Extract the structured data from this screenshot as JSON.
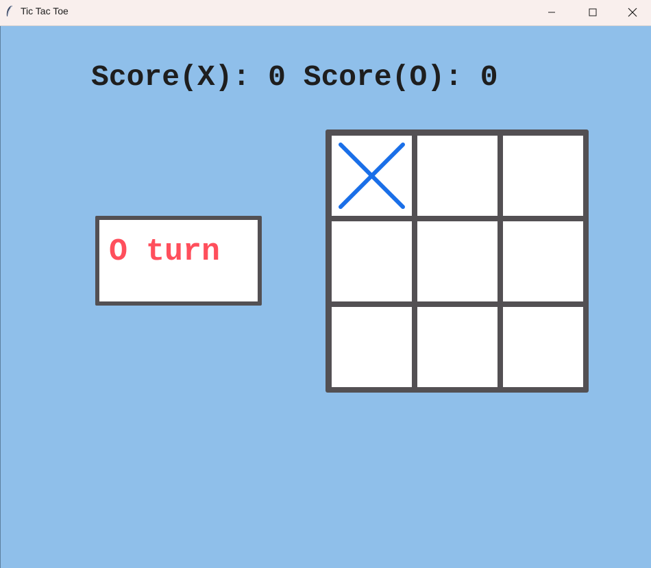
{
  "window": {
    "title": "Tic Tac Toe",
    "controls": [
      "minimize-icon",
      "maximize-icon",
      "close-icon"
    ]
  },
  "score": {
    "x_label": "Score(X):",
    "x_value": "0",
    "o_label": "Score(O):",
    "o_value": "0"
  },
  "turn": {
    "text": "O turn",
    "color": "#ff4f5c"
  },
  "board": {
    "cells": [
      "X",
      "",
      "",
      "",
      "",
      "",
      "",
      "",
      ""
    ],
    "x_color": "#1a6fe8",
    "grid_color": "#535053",
    "cell_color": "#ffffff"
  },
  "colors": {
    "background": "#8fbfea",
    "titlebar": "#f9efed"
  }
}
